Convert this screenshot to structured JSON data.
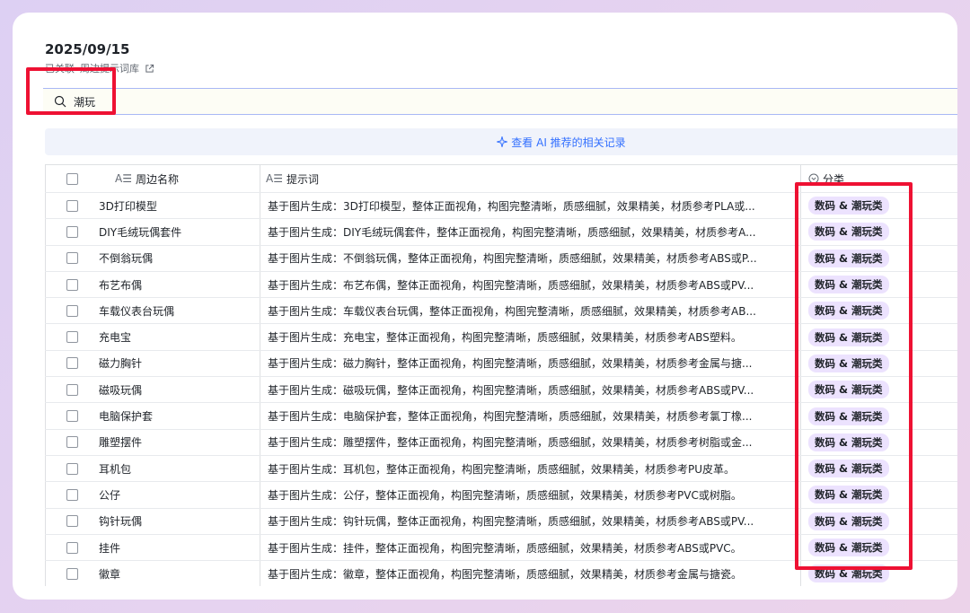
{
  "header": {
    "date": "2025/09/15",
    "linked_label": "已关联",
    "linked_library": "周边提示词库"
  },
  "search": {
    "value": "潮玩",
    "placeholder": ""
  },
  "ai_recommend": {
    "label": "查看 AI 推荐的相关记录"
  },
  "table": {
    "columns": {
      "name": "周边名称",
      "prompt": "提示词",
      "category": "分类"
    },
    "rows": [
      {
        "name": "3D打印模型",
        "prompt": "基于图片生成：3D打印模型，整体正面视角，构图完整清晰，质感细腻，效果精美，材质参考PLA或...",
        "category": "数码 & 潮玩类"
      },
      {
        "name": "DIY毛绒玩偶套件",
        "prompt": "基于图片生成：DIY毛绒玩偶套件，整体正面视角，构图完整清晰，质感细腻，效果精美，材质参考A...",
        "category": "数码 & 潮玩类"
      },
      {
        "name": "不倒翁玩偶",
        "prompt": "基于图片生成：不倒翁玩偶，整体正面视角，构图完整清晰，质感细腻，效果精美，材质参考ABS或P...",
        "category": "数码 & 潮玩类"
      },
      {
        "name": "布艺布偶",
        "prompt": "基于图片生成：布艺布偶，整体正面视角，构图完整清晰，质感细腻，效果精美，材质参考ABS或PV...",
        "category": "数码 & 潮玩类"
      },
      {
        "name": "车载仪表台玩偶",
        "prompt": "基于图片生成：车载仪表台玩偶，整体正面视角，构图完整清晰，质感细腻，效果精美，材质参考AB...",
        "category": "数码 & 潮玩类"
      },
      {
        "name": "充电宝",
        "prompt": "基于图片生成：充电宝，整体正面视角，构图完整清晰，质感细腻，效果精美，材质参考ABS塑料。",
        "category": "数码 & 潮玩类"
      },
      {
        "name": "磁力胸针",
        "prompt": "基于图片生成：磁力胸针，整体正面视角，构图完整清晰，质感细腻，效果精美，材质参考金属与搪...",
        "category": "数码 & 潮玩类"
      },
      {
        "name": "磁吸玩偶",
        "prompt": "基于图片生成：磁吸玩偶，整体正面视角，构图完整清晰，质感细腻，效果精美，材质参考ABS或PV...",
        "category": "数码 & 潮玩类"
      },
      {
        "name": "电脑保护套",
        "prompt": "基于图片生成：电脑保护套，整体正面视角，构图完整清晰，质感细腻，效果精美，材质参考氯丁橡...",
        "category": "数码 & 潮玩类"
      },
      {
        "name": "雕塑摆件",
        "prompt": "基于图片生成：雕塑摆件，整体正面视角，构图完整清晰，质感细腻，效果精美，材质参考树脂或金...",
        "category": "数码 & 潮玩类"
      },
      {
        "name": "耳机包",
        "prompt": "基于图片生成：耳机包，整体正面视角，构图完整清晰，质感细腻，效果精美，材质参考PU皮革。",
        "category": "数码 & 潮玩类"
      },
      {
        "name": "公仔",
        "prompt": "基于图片生成：公仔，整体正面视角，构图完整清晰，质感细腻，效果精美，材质参考PVC或树脂。",
        "category": "数码 & 潮玩类"
      },
      {
        "name": "钩针玩偶",
        "prompt": "基于图片生成：钩针玩偶，整体正面视角，构图完整清晰，质感细腻，效果精美，材质参考ABS或PV...",
        "category": "数码 & 潮玩类"
      },
      {
        "name": "挂件",
        "prompt": "基于图片生成：挂件，整体正面视角，构图完整清晰，质感细腻，效果精美，材质参考ABS或PVC。",
        "category": "数码 & 潮玩类"
      },
      {
        "name": "徽章",
        "prompt": "基于图片生成：徽章，整体正面视角，构图完整清晰，质感细腻，效果精美，材质参考金属与搪瓷。",
        "category": "数码 & 潮玩类"
      }
    ]
  },
  "colors": {
    "accent": "#3370ff",
    "badge_bg": "#ece2fe",
    "highlight": "#ee1133",
    "card_bg": "#ffffff"
  },
  "icons": {
    "search": "search-icon",
    "external": "external-link-icon",
    "sparkle": "sparkle-icon",
    "text_field": "text-field-icon",
    "single_select": "single-select-icon"
  }
}
